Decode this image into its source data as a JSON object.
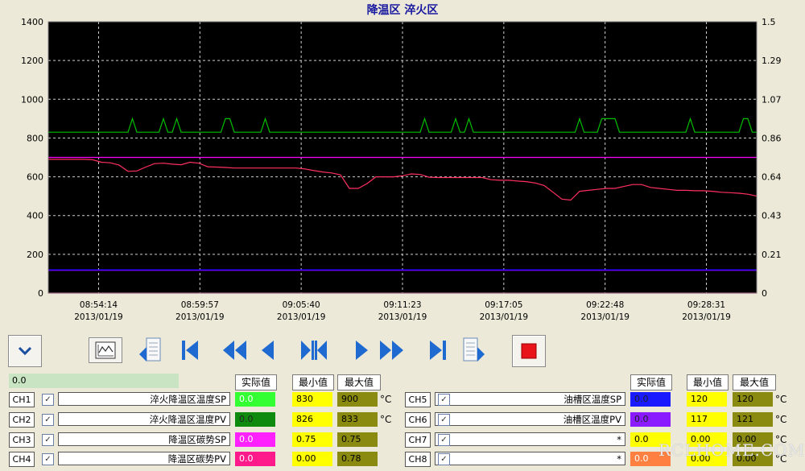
{
  "title": "降温区 淬火区",
  "chart_data": {
    "type": "line",
    "title": "降温区 淬火区",
    "y_left": {
      "ticks": [
        "1400",
        "1200",
        "1000",
        "800",
        "600",
        "400",
        "200",
        "0"
      ],
      "range": [
        0,
        1400
      ]
    },
    "y_right": {
      "ticks": [
        "1.5",
        "1.29",
        "1.07",
        "0.86",
        "0.64",
        "0.43",
        "0.21",
        "0"
      ],
      "range": [
        0,
        1.5
      ]
    },
    "x_ticks": [
      {
        "time": "08:54:14",
        "date": "2013/01/19"
      },
      {
        "time": "08:59:57",
        "date": "2013/01/19"
      },
      {
        "time": "09:05:40",
        "date": "2013/01/19"
      },
      {
        "time": "09:11:23",
        "date": "2013/01/19"
      },
      {
        "time": "09:17:05",
        "date": "2013/01/19"
      },
      {
        "time": "09:22:48",
        "date": "2013/01/19"
      },
      {
        "time": "09:28:31",
        "date": "2013/01/19"
      }
    ],
    "grid": true,
    "series": [
      {
        "name": "淬火降温区温度SP",
        "color": "#00c000",
        "axis": "left",
        "t": [
          0,
          2,
          2.5,
          3,
          3.5,
          4,
          4.5,
          5,
          5.5,
          6,
          6.5,
          7,
          7.5,
          8,
          8.5,
          9,
          9.5,
          10,
          10.5,
          11,
          11.5,
          12,
          12.5,
          13,
          13.5,
          14,
          14.5,
          15,
          15.5,
          16,
          16.5,
          17,
          17.5,
          18,
          18.5,
          19,
          19.5,
          20,
          20.5,
          21,
          21.5,
          22,
          22.5,
          23,
          23.5,
          24,
          24.5,
          25,
          25.5,
          26,
          26.5,
          27,
          27.5,
          28,
          28.5,
          29,
          29.5,
          30,
          30.5,
          31,
          31.5,
          32,
          32.5,
          33,
          33.5,
          34,
          34.5,
          35,
          35.5,
          36,
          36.5,
          37,
          37.5,
          38,
          38.5,
          39,
          39.5,
          40,
          40.5,
          41,
          41.5,
          42,
          42.5,
          43,
          43.5,
          44,
          44.5,
          45,
          45.5,
          46,
          46.5,
          47,
          47.5,
          48,
          48.5,
          49,
          49.5,
          50,
          50.5,
          51,
          51.5,
          52,
          52.5,
          53,
          53.5,
          54,
          54.5,
          55,
          55.5,
          56,
          56.5,
          57,
          57.5,
          58,
          58.5,
          59,
          59.5,
          60,
          60.5,
          61,
          61.5,
          62,
          62.5,
          63,
          63.5,
          64,
          64.5,
          65,
          65.5,
          66,
          66.5,
          67,
          67.5,
          68,
          68.5,
          69,
          69.5,
          70,
          70.5,
          71,
          71.5,
          72,
          72.5,
          73,
          73.5,
          74,
          74.5,
          75,
          75.5,
          76,
          76.5,
          77,
          77.5,
          78,
          78.5,
          79,
          79.5,
          80
        ],
        "v": [
          830,
          830,
          830,
          830,
          830,
          830,
          830,
          830,
          830,
          830,
          830,
          830,
          830,
          830,
          830,
          830,
          900,
          830,
          830,
          830,
          830,
          830,
          830,
          900,
          830,
          830,
          900,
          830,
          830,
          830,
          830,
          830,
          830,
          830,
          830,
          830,
          830,
          900,
          900,
          830,
          830,
          830,
          830,
          830,
          830,
          830,
          900,
          830,
          830,
          830,
          830,
          830,
          830,
          830,
          830,
          830,
          830,
          830,
          830,
          830,
          830,
          830,
          830,
          830,
          830,
          830,
          830,
          830,
          830,
          830,
          830,
          830,
          830,
          830,
          830,
          830,
          830,
          830,
          830,
          830,
          830,
          830,
          900,
          830,
          830,
          830,
          830,
          830,
          830,
          900,
          830,
          830,
          900,
          830,
          830,
          830,
          830,
          830,
          830,
          830,
          830,
          830,
          830,
          830,
          830,
          830,
          830,
          830,
          830,
          830,
          830,
          830,
          830,
          830,
          830,
          830,
          830,
          900,
          830,
          830,
          830,
          830,
          900,
          900,
          900,
          900,
          830,
          830,
          830,
          830,
          830,
          830,
          830,
          830,
          830,
          830,
          830,
          830,
          830,
          830,
          830,
          830,
          900,
          830,
          830,
          830,
          830,
          830,
          830,
          830,
          830,
          830,
          830,
          830,
          900,
          900,
          830,
          830,
          830,
          830,
          830,
          900,
          830,
          830,
          830,
          830,
          830
        ]
      },
      {
        "name": "淬火降温区温度PV",
        "color": "#ff3060",
        "axis": "left",
        "t": [
          0,
          1,
          2,
          3,
          4,
          5,
          6,
          7,
          8,
          9,
          10,
          11,
          12,
          13,
          14,
          15,
          16,
          17,
          18,
          19,
          20,
          21,
          22,
          23,
          24,
          25,
          26,
          27,
          28,
          29,
          30,
          31,
          32,
          33,
          34,
          35,
          36,
          37,
          38,
          39,
          40,
          41,
          42,
          43,
          44,
          45,
          46,
          47,
          48,
          49,
          50,
          51,
          52,
          53,
          54,
          55,
          56,
          57,
          58,
          59,
          60,
          61,
          62,
          63,
          64,
          65,
          66,
          67,
          68,
          69,
          70,
          71,
          72,
          73,
          74,
          75,
          76,
          77,
          78,
          79,
          80
        ],
        "v": [
          690,
          690,
          690,
          690,
          690,
          688,
          675,
          672,
          660,
          628,
          630,
          650,
          668,
          670,
          665,
          662,
          675,
          670,
          652,
          650,
          648,
          645,
          645,
          645,
          645,
          645,
          645,
          645,
          645,
          640,
          632,
          625,
          620,
          610,
          540,
          540,
          565,
          600,
          600,
          600,
          605,
          615,
          612,
          598,
          596,
          596,
          596,
          596,
          596,
          596,
          585,
          582,
          582,
          578,
          575,
          568,
          555,
          520,
          485,
          480,
          525,
          530,
          535,
          540,
          540,
          550,
          560,
          560,
          545,
          540,
          535,
          530,
          530,
          528,
          528,
          525,
          520,
          518,
          515,
          510,
          500
        ]
      },
      {
        "name": "降温区碳势SP",
        "color": "#ff00ff",
        "axis": "right",
        "t": [
          0,
          80
        ],
        "v": [
          0.75,
          0.75
        ]
      },
      {
        "name": "降温区碳势PV",
        "color": "#ff0080",
        "axis": "right",
        "t": [
          0,
          80
        ],
        "v": [
          0.0,
          0.0
        ]
      },
      {
        "name": "油槽区温度SP",
        "color": "#0000ff",
        "axis": "left",
        "t": [
          0,
          80
        ],
        "v": [
          120,
          120
        ]
      },
      {
        "name": "油槽区温度PV",
        "color": "#8000ff",
        "axis": "left",
        "t": [
          0,
          80
        ],
        "v": [
          117,
          117
        ]
      }
    ]
  },
  "toolbar": {
    "icons": [
      "chevron-down-icon",
      "trend-chart-icon",
      "page-back-icon",
      "jump-start-icon",
      "fast-rewind-icon",
      "step-back-icon",
      "center-icon",
      "step-forward-icon",
      "fast-forward-icon",
      "jump-end-icon",
      "page-forward-icon",
      "stop-icon"
    ]
  },
  "status_value": "0.0",
  "headers": {
    "actual": "实际值",
    "min": "最小值",
    "max": "最大值"
  },
  "unit": "°C",
  "channels_left": [
    {
      "ch": "CH1",
      "name": "淬火降温区温度SP",
      "actual": "0.0",
      "actual_color": "#33ff33",
      "min": "830",
      "max": "900",
      "unit": "°C",
      "checked": true
    },
    {
      "ch": "CH2",
      "name": "淬火降温区温度PV",
      "actual": "0.0",
      "actual_color": "#0e8a0e",
      "min": "826",
      "max": "833",
      "unit": "°C",
      "checked": true
    },
    {
      "ch": "CH3",
      "name": "降温区碳势SP",
      "actual": "0.0",
      "actual_color": "#ff22ff",
      "min": "0.75",
      "max": "0.75",
      "unit": "",
      "checked": true
    },
    {
      "ch": "CH4",
      "name": "降温区碳势PV",
      "actual": "0.0",
      "actual_color": "#ff1a8c",
      "min": "0.00",
      "max": "0.78",
      "unit": "",
      "checked": true
    }
  ],
  "channels_right": [
    {
      "ch": "CH5",
      "name": "油槽区温度SP",
      "actual": "0.0",
      "actual_color": "#1a1aff",
      "min": "120",
      "max": "120",
      "unit": "°C",
      "checked": true
    },
    {
      "ch": "CH6",
      "name": "油槽区温度PV",
      "actual": "0.0",
      "actual_color": "#8a1aff",
      "min": "117",
      "max": "121",
      "unit": "°C",
      "checked": true
    },
    {
      "ch": "CH7",
      "name": "*",
      "actual": "0.0",
      "actual_color": "#ffff00",
      "min": "0.00",
      "max": "0.00",
      "unit": "°C",
      "checked": true
    },
    {
      "ch": "CH8",
      "name": "*",
      "actual": "0.0",
      "actual_color": "#ff8040",
      "min": "0.00",
      "max": "0.00",
      "unit": "°C",
      "checked": true
    }
  ],
  "colors": {
    "min_bg": "#ffff00",
    "max_bg": "#8a8a10",
    "plot_bg": "#000000"
  },
  "watermark": "RCLHOME.COM"
}
